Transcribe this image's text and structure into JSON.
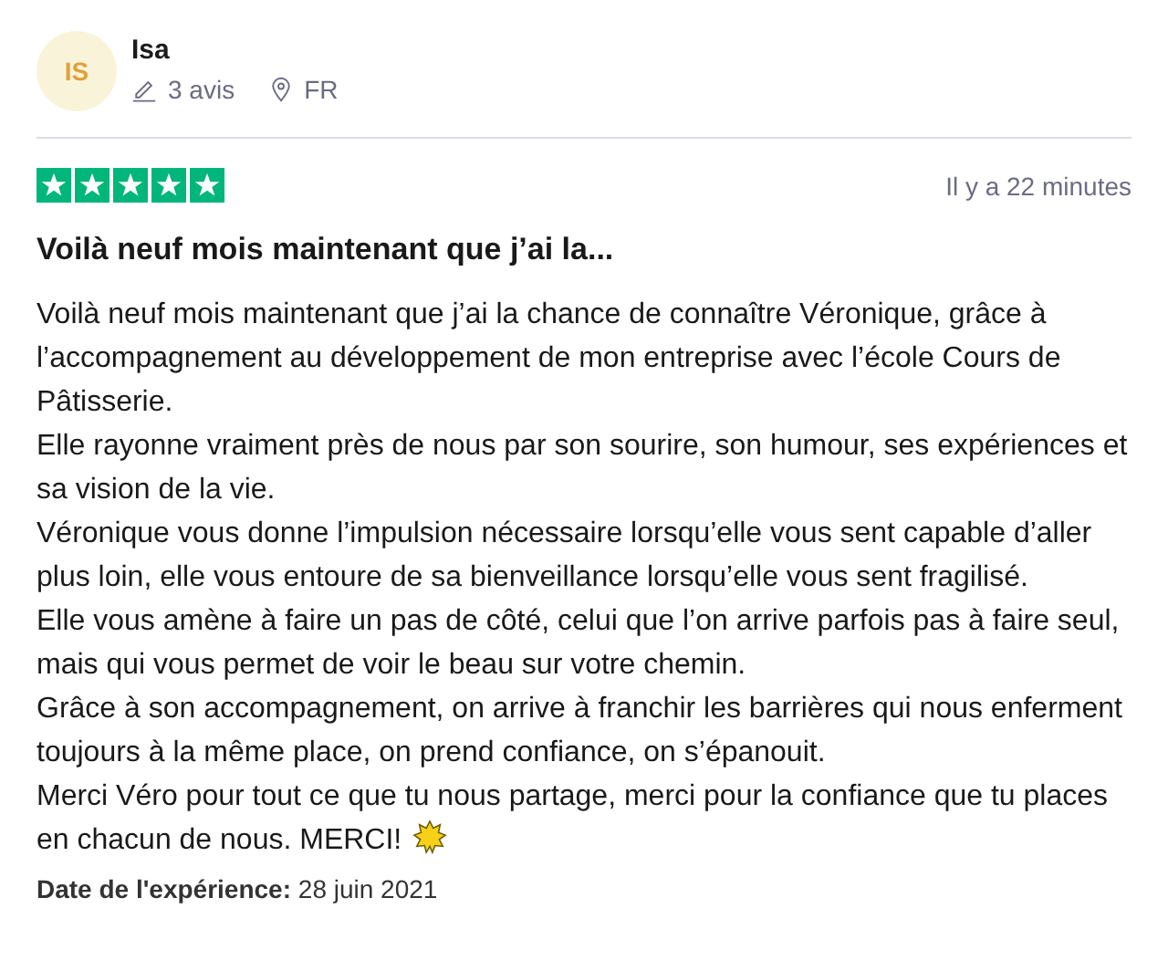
{
  "reviewer": {
    "initials": "IS",
    "name": "Isa",
    "reviews": "3 avis",
    "country": "FR"
  },
  "review": {
    "stars": 5,
    "time": "Il y a 22 minutes",
    "title": "Voilà neuf mois maintenant que j’ai la...",
    "paragraphs": [
      "Voilà neuf mois maintenant que j’ai la chance de connaître Véronique, grâce à l’accompagnement au développement de mon entreprise avec l’école Cours de Pâtisserie.",
      "Elle rayonne vraiment près de nous par son sourire, son humour, ses expériences et sa vision de la vie.",
      "Véronique vous donne l’impulsion nécessaire lorsqu’elle vous sent capable d’aller plus loin, elle vous entoure de sa bienveillance lorsqu’elle vous sent fragilisé.",
      "Elle vous amène à faire un pas de côté, celui que l’on arrive parfois pas à faire seul, mais qui vous permet de voir le beau sur votre chemin.",
      "Grâce à son accompagnement, on arrive à franchir les barrières qui nous enferment toujours à la même place, on prend confiance, on s’épanouit.",
      "Merci Véro pour tout ce que tu nous partage, merci pour la confiance que tu places en chacun de nous. MERCI!"
    ],
    "date": "**Date de l'expérience:** 28 juin 2021"
  }
}
